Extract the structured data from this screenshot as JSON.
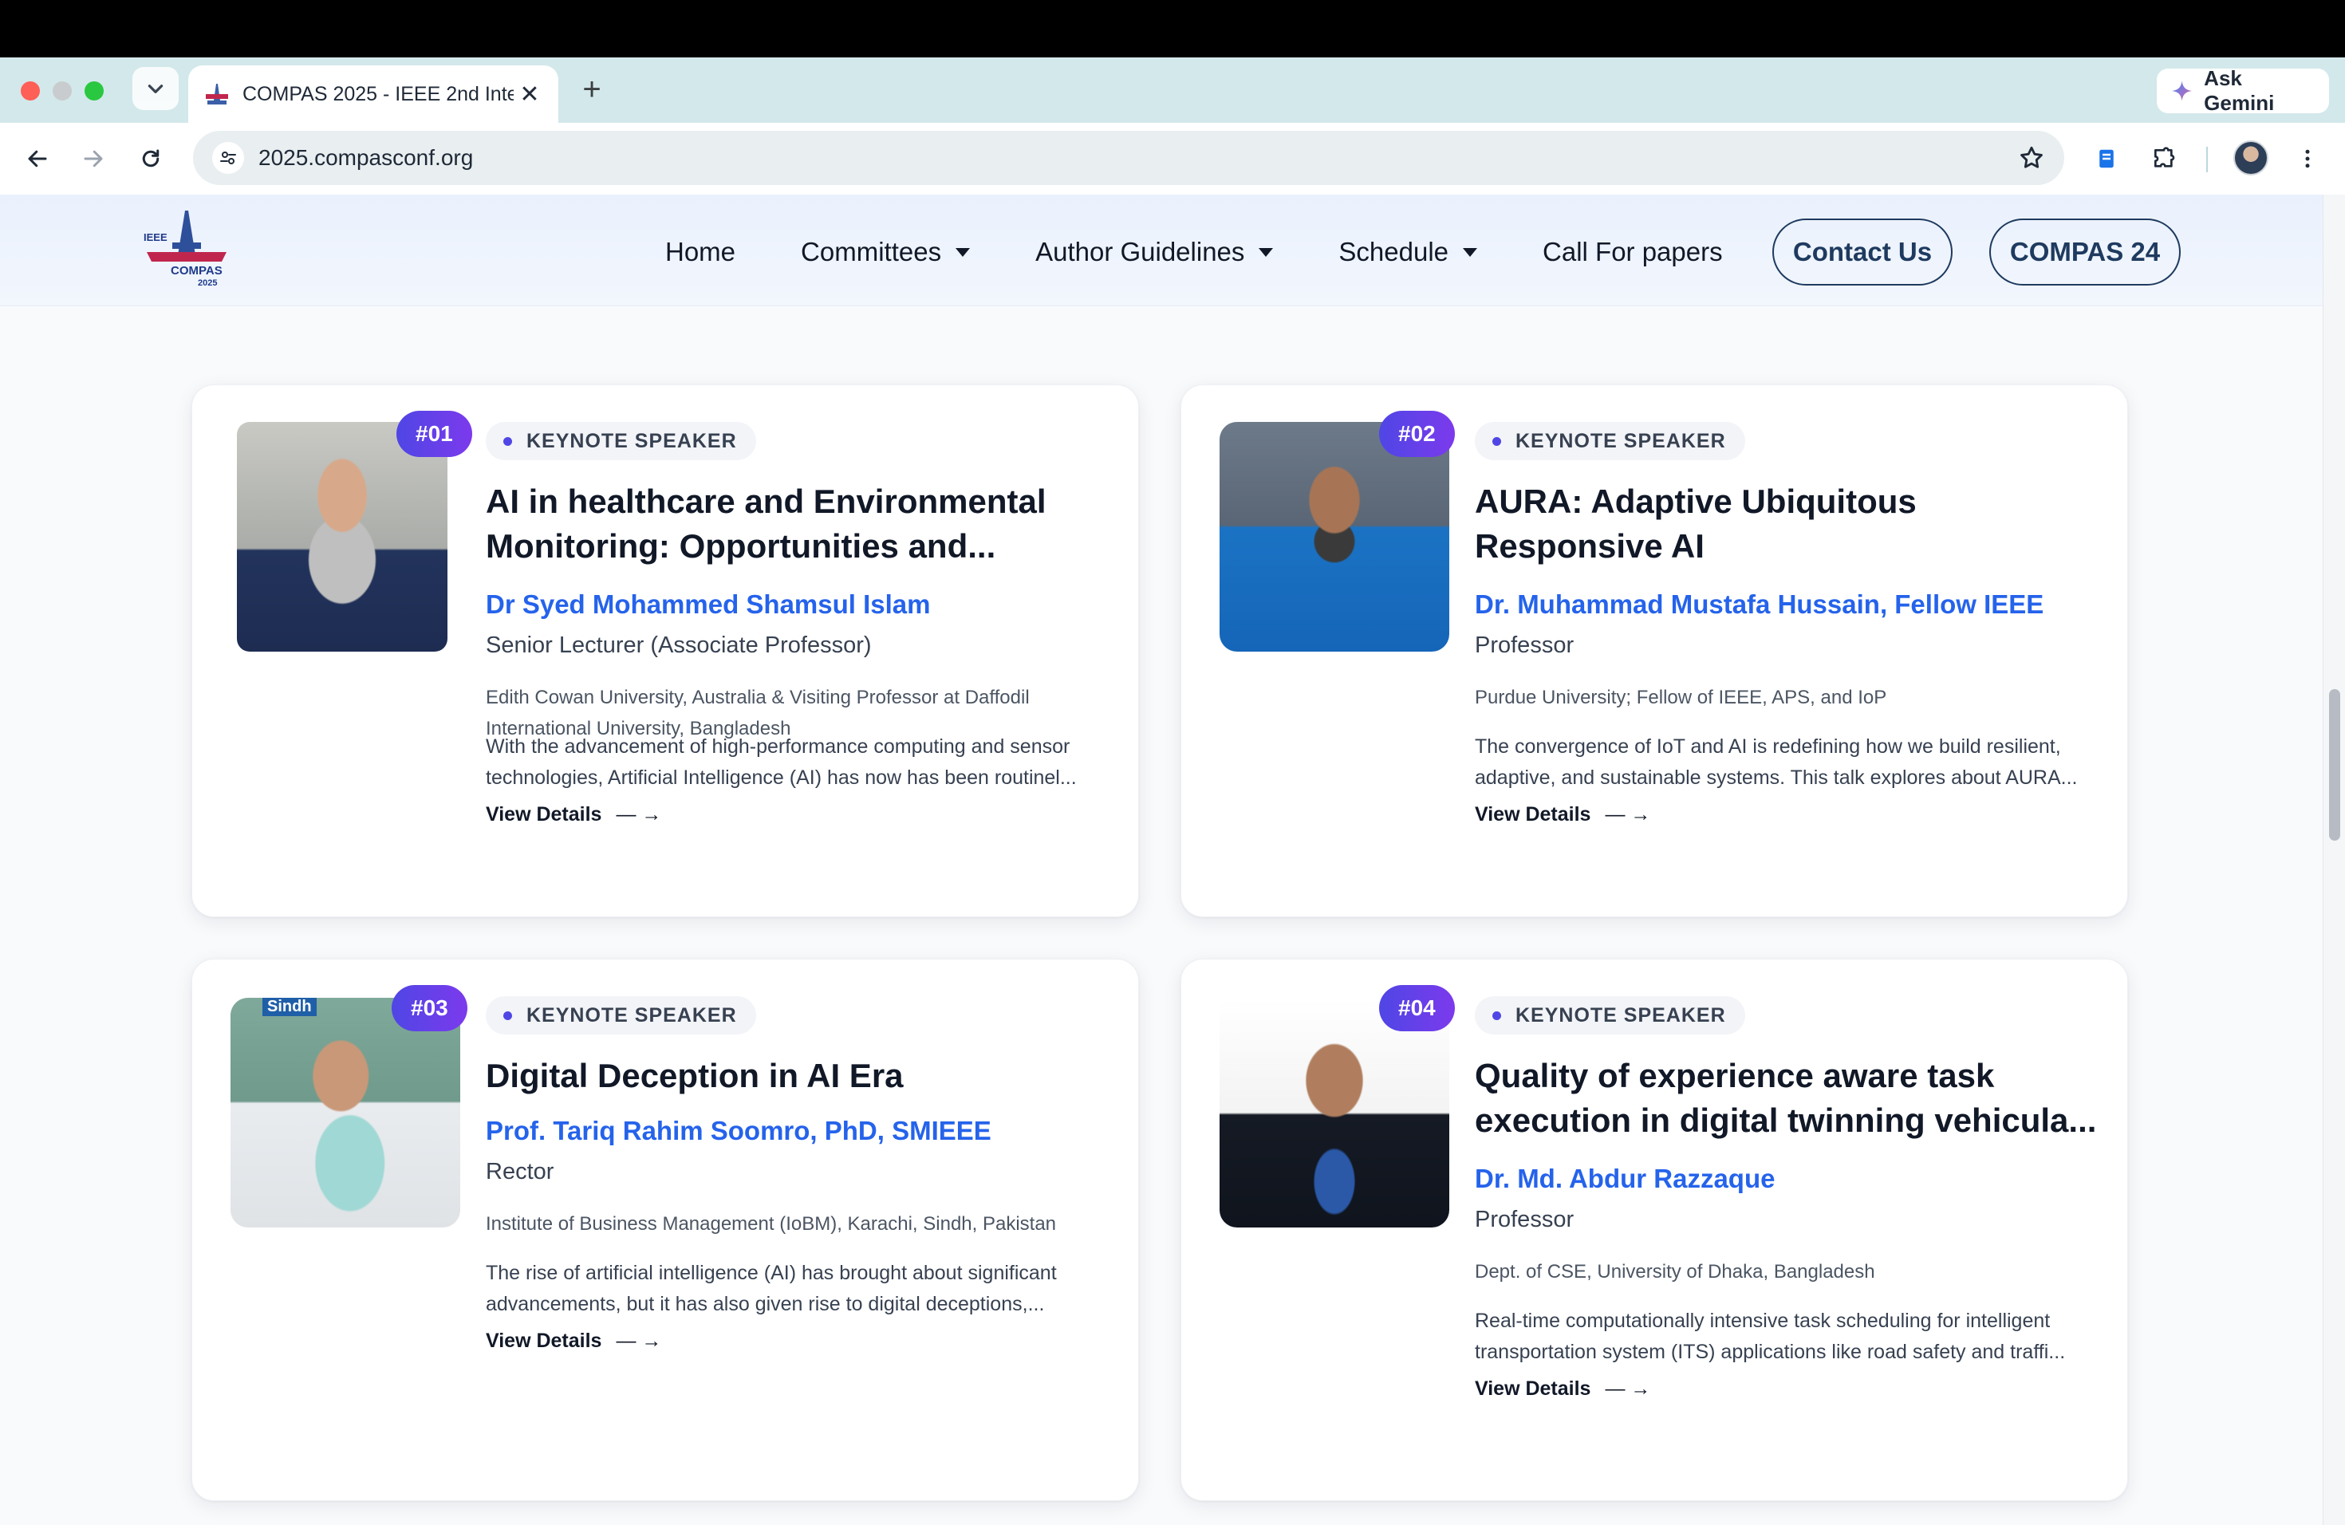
{
  "browser": {
    "tab_title": "COMPAS 2025 - IEEE 2nd Inte",
    "url": "2025.compasconf.org",
    "gemini_label": "Ask Gemini",
    "icons": [
      "back-icon",
      "forward-icon",
      "reload-icon",
      "site-info-icon",
      "bookmark-star-icon",
      "extensions-icon",
      "profile-avatar"
    ]
  },
  "header": {
    "logo_text": {
      "top": "IEEE",
      "bottom": "COMPAS",
      "year": "2025"
    },
    "nav": [
      {
        "label": "Home",
        "dropdown": false
      },
      {
        "label": "Committees",
        "dropdown": true
      },
      {
        "label": "Author Guidelines",
        "dropdown": true
      },
      {
        "label": "Schedule",
        "dropdown": true
      },
      {
        "label": "Call For papers",
        "dropdown": false
      }
    ],
    "contact_label": "Contact Us",
    "compas24_label": "COMPAS 24"
  },
  "speakers": [
    {
      "badge": "#01",
      "tag": "KEYNOTE SPEAKER",
      "title": "AI in healthcare and Environmental Monitoring: Opportunities and...",
      "name": "Dr Syed Mohammed Shamsul Islam",
      "role": "Senior Lecturer (Associate Professor)",
      "affiliation": "Edith Cowan University, Australia & Visiting Professor at Daffodil International University, Bangladesh",
      "description": "With the advancement of high-performance computing and sensor technologies, Artificial Intelligence (AI) has now has been routinel...",
      "view_label": "View Details",
      "arrow": "— →"
    },
    {
      "badge": "#02",
      "tag": "KEYNOTE SPEAKER",
      "title": "AURA: Adaptive Ubiquitous Responsive AI",
      "name": "Dr. Muhammad Mustafa Hussain, Fellow IEEE",
      "role": "Professor",
      "affiliation": "Purdue University; Fellow of IEEE, APS, and IoP",
      "description": "The convergence of IoT and AI is redefining how we build resilient, adaptive, and sustainable systems. This talk explores about AURA...",
      "view_label": "View Details",
      "arrow": "— →"
    },
    {
      "badge": "#03",
      "tag": "KEYNOTE SPEAKER",
      "title": "Digital Deception in AI Era",
      "name": "Prof. Tariq Rahim Soomro, PhD, SMIEEE",
      "role": "Rector",
      "affiliation": "Institute of Business Management (IoBM), Karachi, Sindh, Pakistan",
      "description": "The rise of artificial intelligence (AI) has brought about significant advancements, but it has also given rise to digital deceptions,...",
      "view_label": "View Details",
      "arrow": "— →",
      "photo_text": "Sindh"
    },
    {
      "badge": "#04",
      "tag": "KEYNOTE SPEAKER",
      "title": "Quality of experience aware task execution in digital twinning vehicula...",
      "name": "Dr. Md. Abdur Razzaque",
      "role": "Professor",
      "affiliation": "Dept. of CSE, University of Dhaka, Bangladesh",
      "description": "Real-time computationally intensive task scheduling for intelligent transportation system (ITS) applications like road safety and traffi...",
      "view_label": "View Details",
      "arrow": "— →"
    }
  ],
  "colors": {
    "accent_blue": "#2563eb",
    "badge_gradient_start": "#4f46e5",
    "badge_gradient_end": "#7c3aed",
    "navy": "#1e3a5f"
  }
}
